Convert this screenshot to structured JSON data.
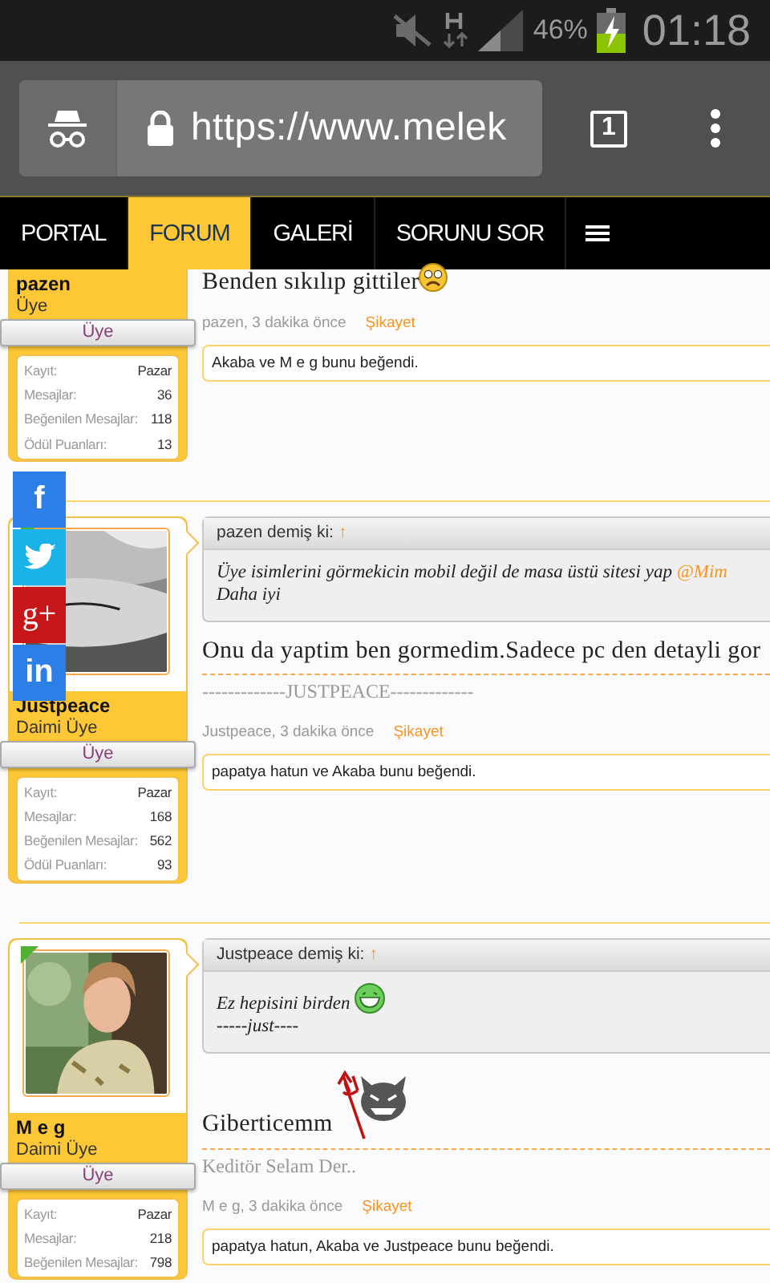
{
  "status_bar": {
    "battery": "46%",
    "time": "01:18"
  },
  "browser": {
    "url": "https://www.melek",
    "tab_count": "1"
  },
  "nav": {
    "tabs": [
      {
        "label": "PORTAL",
        "selected": false
      },
      {
        "label": "FORUM",
        "selected": true
      },
      {
        "label": "GALERİ",
        "selected": false
      },
      {
        "label": "SORUNU SOR",
        "selected": false
      }
    ]
  },
  "posts": [
    {
      "user": {
        "name": "pazen",
        "title": "Üye",
        "banner": "Üye"
      },
      "stats": [
        {
          "label": "Kayıt:",
          "value": "Pazar"
        },
        {
          "label": "Mesajlar:",
          "value": "36"
        },
        {
          "label": "Beğenilen Mesajlar:",
          "value": "118"
        },
        {
          "label": "Ödül Puanları:",
          "value": "13"
        }
      ],
      "message": [
        {
          "kind": "text",
          "text": "Benden sıkılıp gittiler"
        },
        {
          "kind": "sad-emoji"
        }
      ],
      "meta": {
        "byline": "pazen, 3 dakika önce",
        "report": "Şikayet"
      },
      "likes": "Akaba ve M e g bunu beğendi."
    },
    {
      "avatar": {
        "kind": "picture"
      },
      "online": true,
      "user": {
        "name": "Justpeace",
        "title": "Daimi Üye",
        "banner": "Üye"
      },
      "stats": [
        {
          "label": "Kayıt:",
          "value": "Pazar"
        },
        {
          "label": "Mesajlar:",
          "value": "168"
        },
        {
          "label": "Beğenilen Mesajlar:",
          "value": "562"
        },
        {
          "label": "Ödül Puanları:",
          "value": "93"
        }
      ],
      "quote": {
        "author": "pazen demiş ki:",
        "arrow": "↑",
        "lines": [
          [
            {
              "kind": "text",
              "text": "Üye isimlerini görmekicin mobil değil de masa üstü sitesi yap "
            },
            {
              "kind": "mention",
              "text": "@Mim"
            }
          ],
          [
            {
              "kind": "text",
              "text": "Daha iyi"
            }
          ]
        ]
      },
      "message": [
        {
          "kind": "text",
          "text": "Onu da yaptim ben gormedim.Sadece pc den detayli gor"
        }
      ],
      "signature": "-------------JUSTPEACE-------------",
      "meta": {
        "byline": "Justpeace, 3 dakika önce",
        "report": "Şikayet"
      },
      "likes": "papatya hatun ve Akaba bunu beğendi."
    },
    {
      "avatar": {
        "kind": "picture"
      },
      "online": true,
      "user": {
        "name": "M e g",
        "title": "Daimi Üye",
        "banner": "Üye"
      },
      "stats": [
        {
          "label": "Kayıt:",
          "value": "Pazar"
        },
        {
          "label": "Mesajlar:",
          "value": "218"
        },
        {
          "label": "Beğenilen Mesajlar:",
          "value": "798"
        }
      ],
      "quote": {
        "author": "Justpeace demiş ki:",
        "arrow": "↑",
        "lines": [
          [
            {
              "kind": "text",
              "text": "Ez hepisini birden "
            },
            {
              "kind": "grin-emoji"
            }
          ],
          [
            {
              "kind": "text",
              "text": "-----just----"
            }
          ]
        ]
      },
      "message": [
        {
          "kind": "text",
          "text": "Giberticemm"
        },
        {
          "kind": "devil-emoji"
        }
      ],
      "signature": "Keditör Selam Der..",
      "meta": {
        "byline": "M e g, 3 dakika önce",
        "report": "Şikayet"
      },
      "likes": "papatya hatun, Akaba ve Justpeace bunu beğendi."
    }
  ],
  "share": [
    {
      "kind": "facebook",
      "label": "f"
    },
    {
      "kind": "twitter"
    },
    {
      "kind": "google",
      "label": "g+"
    },
    {
      "kind": "linkedin",
      "label": "in"
    }
  ]
}
